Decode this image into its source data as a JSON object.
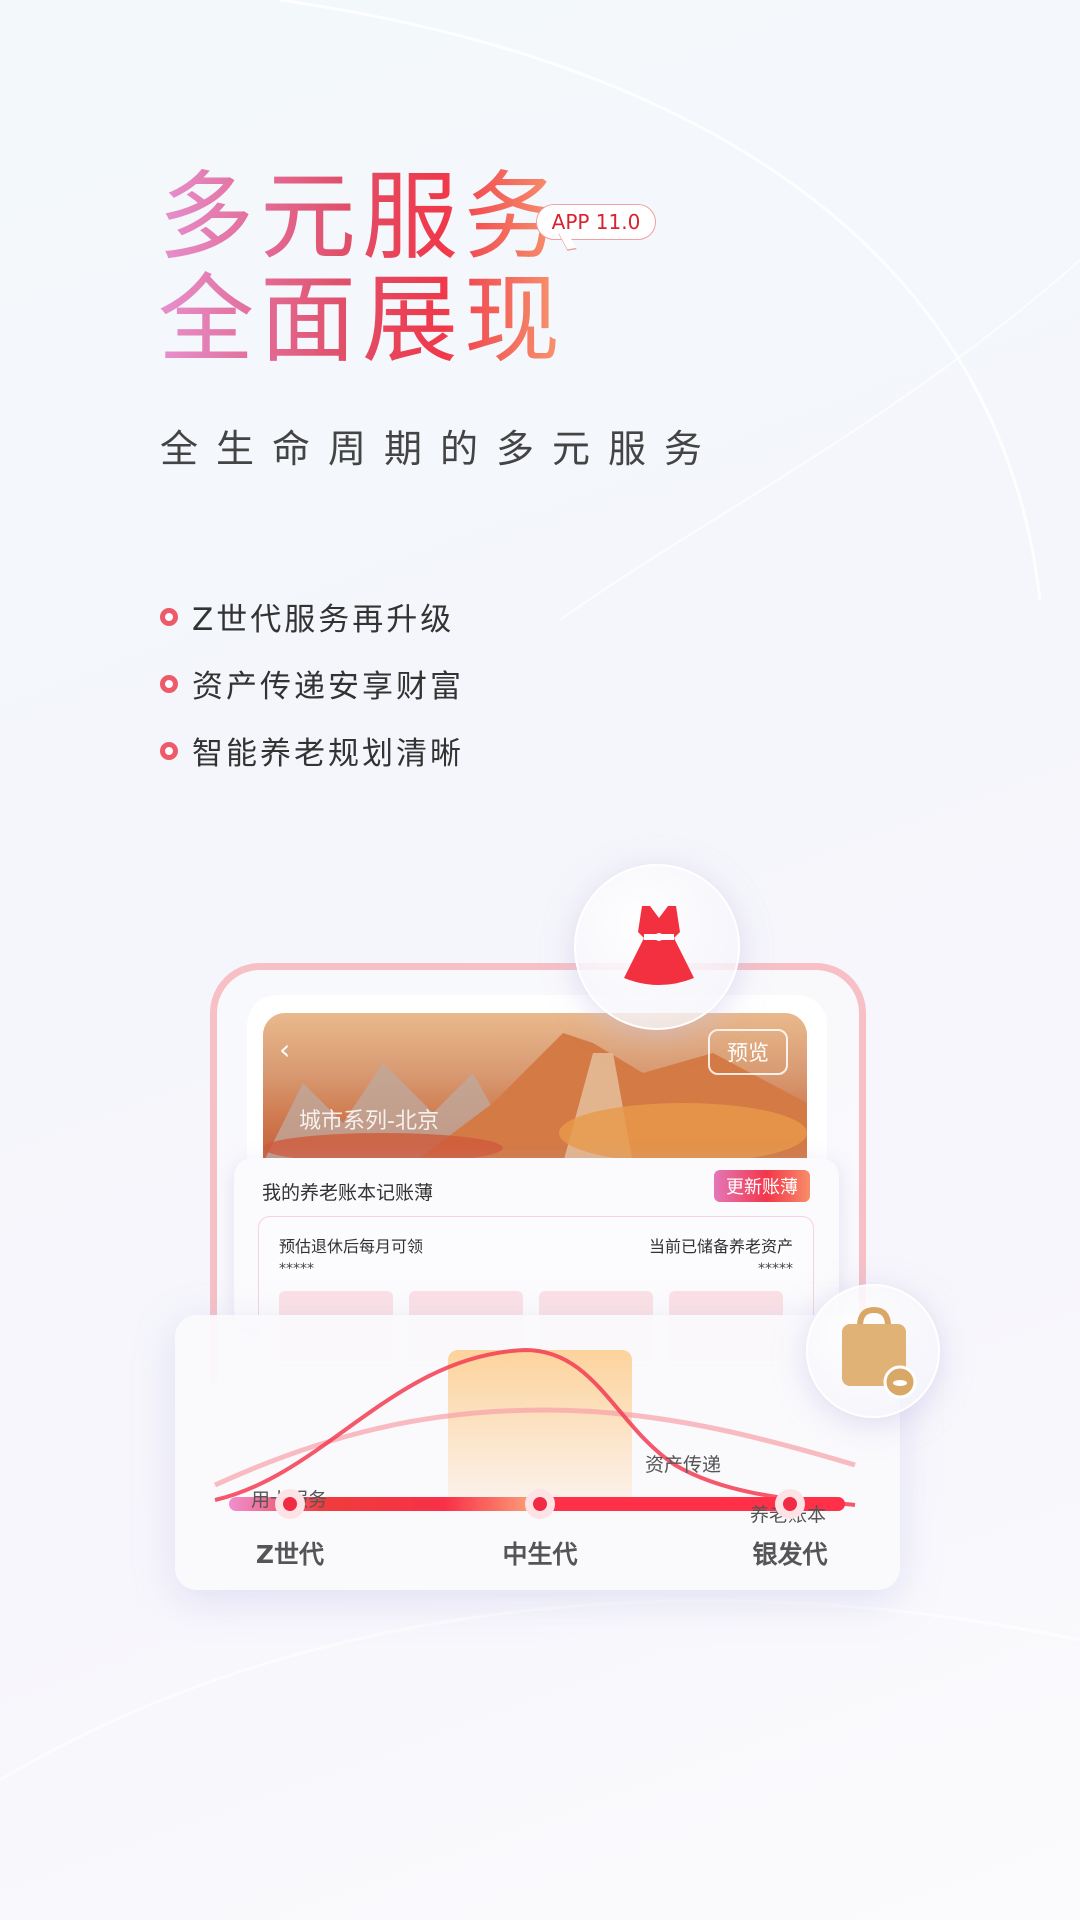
{
  "hero": {
    "title_line1": "多元服务",
    "title_line2": "全面展现",
    "version_badge": "APP 11.0",
    "subtitle": "全生命周期的多元服务"
  },
  "features": [
    {
      "label": "Z世代服务再升级"
    },
    {
      "label": "资产传递安享财富"
    },
    {
      "label": "智能养老规划清晰"
    }
  ],
  "phone": {
    "banner": {
      "title": "城市系列-北京",
      "preview_button": "预览",
      "back_icon": "chevron-left-icon"
    },
    "card": {
      "title": "我的养老账本记账薄",
      "update_button": "更新账薄",
      "left_label": "预估退休后每月可领",
      "left_value": "*****",
      "right_label": "当前已储备养老资产",
      "right_value": "*****"
    }
  },
  "lifecycle": {
    "curve_labels": {
      "card_service": "用卡服务",
      "asset_transfer": "资产传递",
      "pension_book": "养老账本"
    },
    "stages": [
      {
        "label": "Z世代"
      },
      {
        "label": "中生代"
      },
      {
        "label": "银发代"
      }
    ]
  },
  "icons": {
    "dress": "dress-icon",
    "bag": "bag-icon"
  },
  "colors": {
    "accent": "#f22b45",
    "title_gradient_start": "#e690cf",
    "title_gradient_end": "#f79a70",
    "highlight": "#fdd6a0"
  }
}
